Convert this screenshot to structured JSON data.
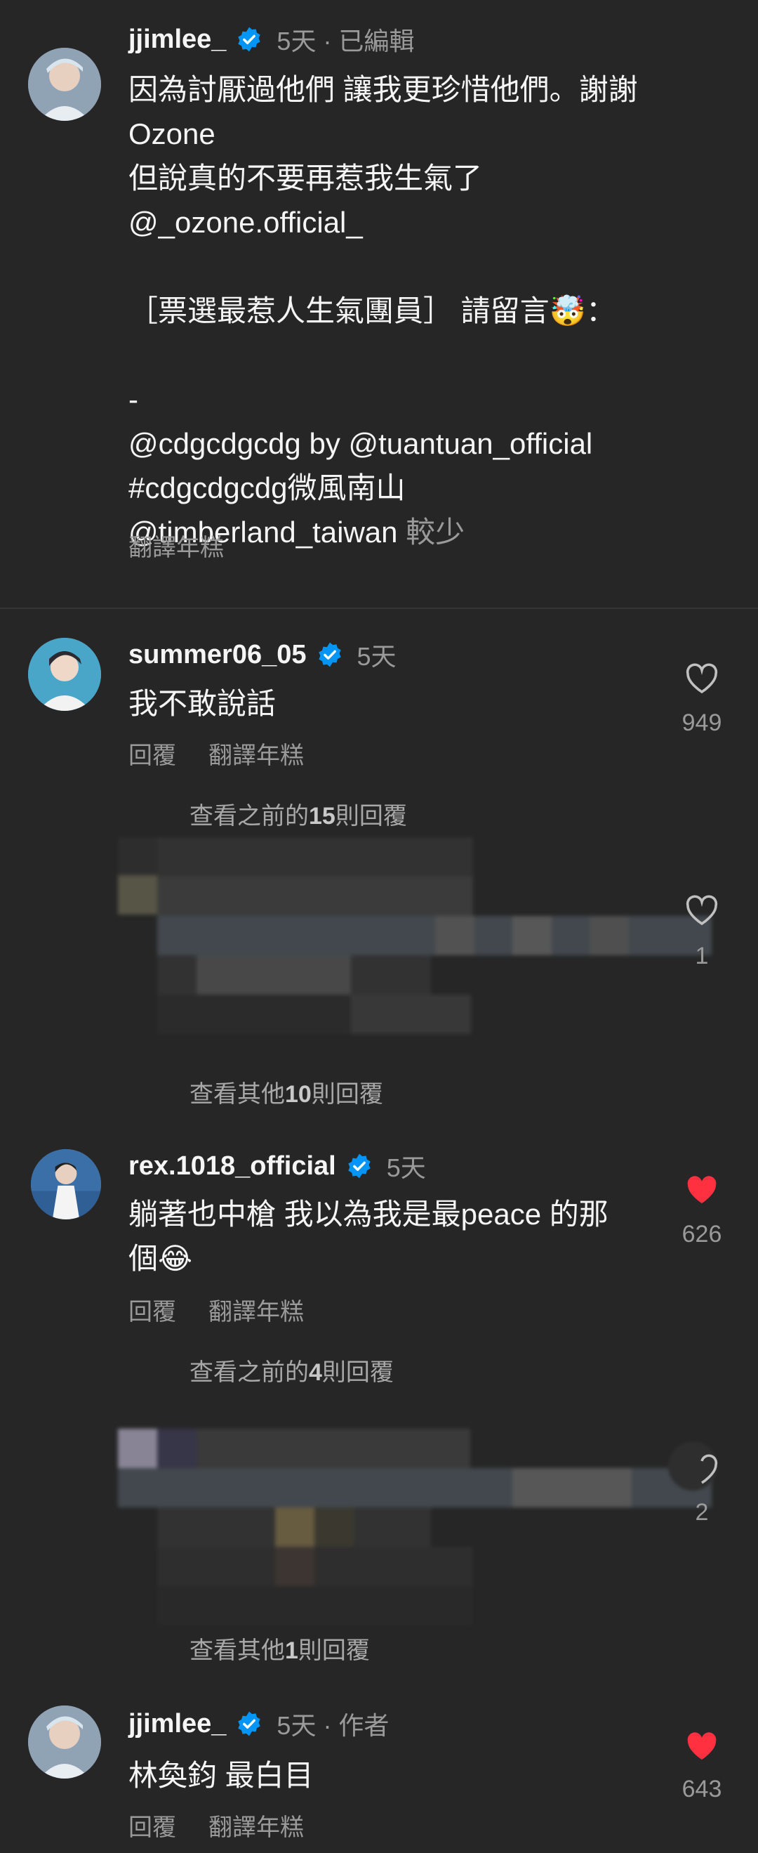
{
  "caption": {
    "username": "jjimlee_",
    "meta": "5天 · 已編輯",
    "lines": [
      "因為討厭過他們 讓我更珍惜他們。謝謝",
      "Ozone",
      "但說真的不要再惹我生氣了",
      "@_ozone.official_",
      "",
      " ［票選最惹人生氣團員］ 請留言🤯：",
      "",
      "-",
      "@cdgcdgcdg by @tuantuan_official",
      "#cdgcdgcdg微風南山",
      "@timberland_taiwan"
    ],
    "less_label": "較少",
    "translate_label": "翻譯年糕"
  },
  "comments": [
    {
      "username": "summer06_05",
      "time": "5天",
      "text_lines": [
        "我不敢說話"
      ],
      "reply_label": "回覆",
      "translate_label": "翻譯年糕",
      "likes": "949",
      "liked": false,
      "view_previous": {
        "prefix": "查看之前的",
        "num": "15",
        "suffix": "則回覆"
      },
      "view_more": {
        "prefix": "查看其他",
        "num": "10",
        "suffix": "則回覆"
      },
      "blurred_reply_likes": "1"
    },
    {
      "username": "rex.1018_official",
      "time": "5天",
      "text_lines": [
        "躺著也中槍 我以為我是最peace 的那",
        "個😂"
      ],
      "reply_label": "回覆",
      "translate_label": "翻譯年糕",
      "likes": "626",
      "liked": true,
      "view_previous": {
        "prefix": "查看之前的",
        "num": "4",
        "suffix": "則回覆"
      },
      "view_more": {
        "prefix": "查看其他",
        "num": "1",
        "suffix": "則回覆"
      },
      "blurred_reply_likes": "2"
    },
    {
      "username": "jjimlee_",
      "meta": "5天 · 作者",
      "text_lines": [
        "林奐鈞 最白目"
      ],
      "reply_label": "回覆",
      "translate_label": "翻譯年糕",
      "likes": "643",
      "liked": true
    }
  ],
  "colors": {
    "background": "#262626",
    "verified": "#0095f6",
    "liked_heart": "#ff3040",
    "secondary_text": "#9a9a9a"
  }
}
